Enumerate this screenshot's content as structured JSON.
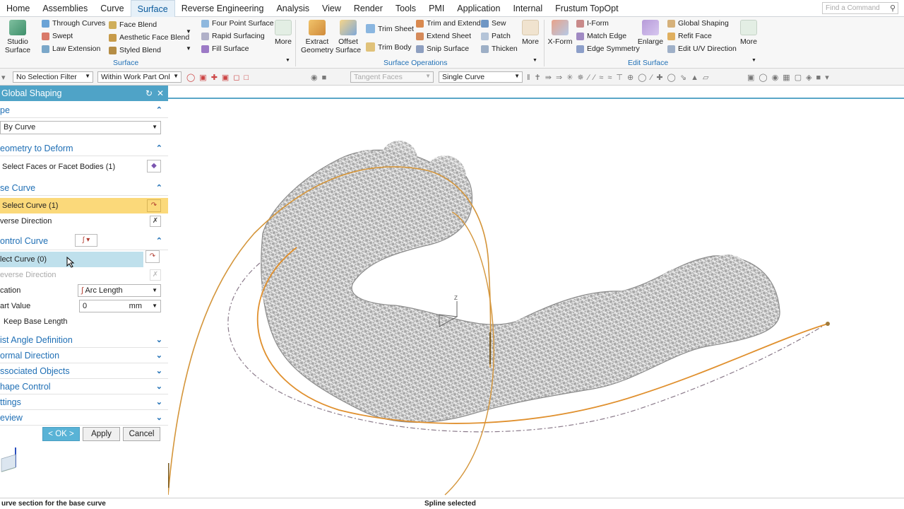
{
  "menu": [
    "Home",
    "Assemblies",
    "Curve",
    "Surface",
    "Reverse Engineering",
    "Analysis",
    "View",
    "Render",
    "Tools",
    "PMI",
    "Application",
    "Internal",
    "Frustum TopOpt"
  ],
  "active_menu": "Surface",
  "search": {
    "placeholder": "Find a Command"
  },
  "ribbon": {
    "studio_surface": "Studio\nSurface",
    "through_curves": "Through Curves",
    "swept": "Swept",
    "law_extension": "Law Extension",
    "face_blend": "Face Blend",
    "aesthetic_face_blend": "Aesthetic Face Blend",
    "styled_blend": "Styled Blend",
    "four_point_surface": "Four Point Surface",
    "rapid_surfacing": "Rapid Surfacing",
    "fill_surface": "Fill Surface",
    "more": "More",
    "group_surface": "Surface",
    "extract_geometry": "Extract\nGeometry",
    "offset_surface": "Offset\nSurface",
    "trim_sheet": "Trim Sheet",
    "trim_body": "Trim Body",
    "trim_and_extend": "Trim and Extend",
    "extend_sheet": "Extend Sheet",
    "snip_surface": "Snip Surface",
    "sew": "Sew",
    "patch": "Patch",
    "thicken": "Thicken",
    "group_surface_operations": "Surface Operations",
    "x_form": "X-Form",
    "i_form": "I-Form",
    "match_edge": "Match Edge",
    "edge_symmetry": "Edge Symmetry",
    "enlarge": "Enlarge",
    "global_shaping": "Global Shaping",
    "refit_face": "Refit Face",
    "edit_uv_direction": "Edit U/V Direction",
    "group_edit_surface": "Edit Surface"
  },
  "toolbar": {
    "selection_filter": "No Selection Filter",
    "scope": "Within Work Part Onl",
    "face_rule": "Tangent Faces",
    "curve_rule": "Single Curve"
  },
  "dialog": {
    "title": "Global Shaping",
    "type_label": "pe",
    "type_value": "By Curve",
    "geometry_label": "eometry to Deform",
    "select_faces": "Select Faces or Facet Bodies (1)",
    "base_curve_label": "se Curve",
    "base_select_curve": "Select Curve (1)",
    "base_reverse": "verse Direction",
    "control_curve_label": "ontrol Curve",
    "control_select_curve": "lect Curve (0)",
    "control_reverse": "everse Direction",
    "location_label": "cation",
    "location_value": "Arc Length",
    "start_value_label": "art Value",
    "start_value": "0",
    "start_unit": "mm",
    "keep_base_length": "Keep Base Length",
    "twist_angle": "ist Angle Definition",
    "normal_direction": "ormal Direction",
    "associated_objects": "ssociated Objects",
    "shape_control": "hape Control",
    "settings": "ttings",
    "preview": "eview",
    "ok": "< OK >",
    "apply": "Apply",
    "cancel": "Cancel"
  },
  "status": {
    "left": "urve section for the base curve",
    "center": "Spline selected"
  },
  "colors": {
    "accent": "#4fa3c7",
    "highlight": "#fbd97a",
    "selected_row": "#bfe0ec",
    "curve": "#d4953a",
    "mesh": "#9a9a9a"
  },
  "triad_label": "Z"
}
